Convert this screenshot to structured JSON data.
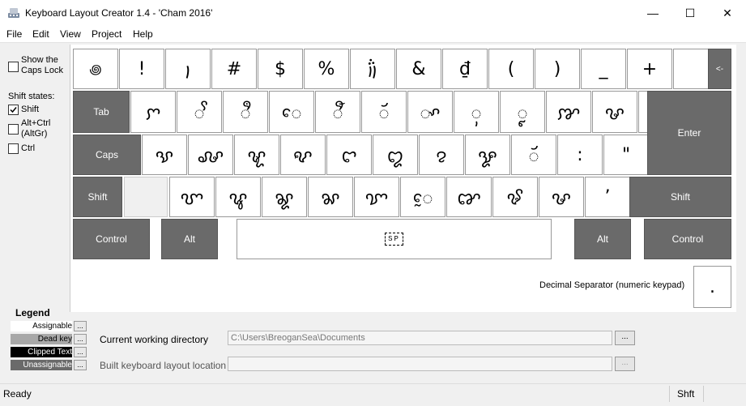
{
  "window": {
    "title": "Keyboard Layout Creator 1.4 - 'Cham 2016'",
    "minimize": "—",
    "maximize": "☐",
    "close": "✕"
  },
  "menu": [
    "File",
    "Edit",
    "View",
    "Project",
    "Help"
  ],
  "options": {
    "caps_lock_label": "Show the\nCaps Lock",
    "shift_states_label": "Shift states:",
    "shift_label": "Shift",
    "altctrl_label": "Alt+Ctrl\n(AltGr)",
    "ctrl_label": "Ctrl",
    "shift_checked": true
  },
  "keys": {
    "row1": [
      "꩜",
      "!",
      "꩝",
      "#",
      "$",
      "%",
      "꩞",
      "&",
      "₫",
      "(",
      ")",
      "_",
      "+",
      "",
      "<-"
    ],
    "row2_tab": "Tab",
    "row2": [
      "ꨆ",
      "ꨩ",
      "ꨫ",
      "ꨯ",
      "ꨬ",
      "ꨮ",
      "ꨳ",
      "ꨲ",
      "ꨵ",
      "ꨇ",
      "ꨔ",
      "ꨙ"
    ],
    "row3_caps": "Caps",
    "row3": [
      "ꨕ",
      "ꨜ",
      "ꨠ",
      "ꨦ",
      "ꨤ",
      "ꨁ",
      "ꨂ",
      "ꨋ",
      "ꨮ",
      ":",
      "\""
    ],
    "row3_enter": "Enter",
    "row4_shift_left": "Shift",
    "row4": [
      "ꨞ",
      "ꨥ",
      "ꨘ",
      "ꨗ",
      "ꨢ",
      "ꨰ",
      "ꨐ",
      "ꨃ",
      "ꨔ",
      "’"
    ],
    "row4_shift_right": "Shift",
    "row5_control_left": "Control",
    "row5_alt_left": "Alt",
    "space": "SP",
    "row5_alt_right": "Alt",
    "row5_control_right": "Control"
  },
  "decimal": {
    "label": "Decimal Separator (numeric keypad)",
    "value": "."
  },
  "legend": {
    "title": "Legend",
    "assignable": "Assignable",
    "dead_key": "Dead key",
    "clipped_text": "Clipped Text",
    "unassignable": "Unassignable",
    "button": "..."
  },
  "directories": {
    "cwd_label": "Current working directory",
    "cwd_value": "C:\\Users\\BreoganSea\\Documents",
    "built_label": "Built keyboard layout location",
    "built_value": "",
    "browse": "..."
  },
  "status": {
    "text": "Ready",
    "state": "Shft"
  }
}
